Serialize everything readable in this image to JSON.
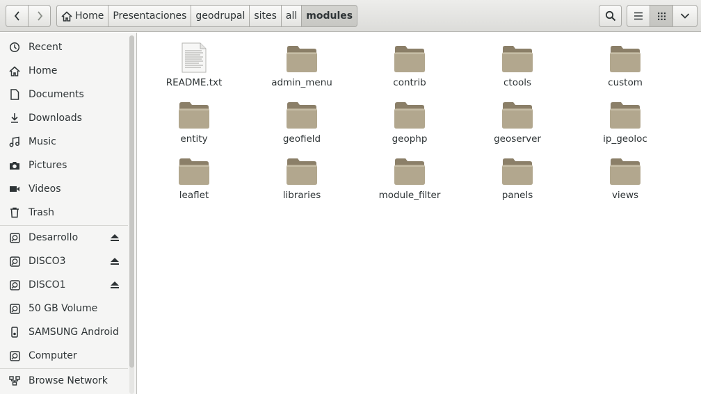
{
  "toolbar": {
    "back_icon": "chevron-left-icon",
    "forward_icon": "chevron-right-icon",
    "breadcrumbs": [
      "Home",
      "Presentaciones",
      "geodrupal",
      "sites",
      "all",
      "modules"
    ],
    "active_crumb": "modules",
    "search_icon": "search-icon",
    "list_view_icon": "list-view-icon",
    "grid_view_icon": "grid-view-icon",
    "menu_icon": "chevron-down-icon"
  },
  "sidebar": {
    "places": [
      {
        "label": "Recent",
        "icon": "clock-icon"
      },
      {
        "label": "Home",
        "icon": "home-icon"
      },
      {
        "label": "Documents",
        "icon": "document-icon"
      },
      {
        "label": "Downloads",
        "icon": "download-icon"
      },
      {
        "label": "Music",
        "icon": "music-icon"
      },
      {
        "label": "Pictures",
        "icon": "camera-icon"
      },
      {
        "label": "Videos",
        "icon": "video-icon"
      },
      {
        "label": "Trash",
        "icon": "trash-icon"
      }
    ],
    "devices": [
      {
        "label": "Desarrollo",
        "icon": "drive-icon",
        "eject": true
      },
      {
        "label": "DISCO3",
        "icon": "drive-icon",
        "eject": true
      },
      {
        "label": "DISCO1",
        "icon": "drive-icon",
        "eject": true
      },
      {
        "label": "50 GB Volume",
        "icon": "drive-icon",
        "eject": false
      },
      {
        "label": "SAMSUNG Android",
        "icon": "phone-icon",
        "eject": false
      },
      {
        "label": "Computer",
        "icon": "drive-icon",
        "eject": false
      }
    ],
    "network": [
      {
        "label": "Browse Network",
        "icon": "network-icon"
      }
    ]
  },
  "files": [
    {
      "name": "README.txt",
      "type": "text-file"
    },
    {
      "name": "admin_menu",
      "type": "folder"
    },
    {
      "name": "contrib",
      "type": "folder"
    },
    {
      "name": "ctools",
      "type": "folder"
    },
    {
      "name": "custom",
      "type": "folder"
    },
    {
      "name": "entity",
      "type": "folder"
    },
    {
      "name": "geofield",
      "type": "folder"
    },
    {
      "name": "geophp",
      "type": "folder"
    },
    {
      "name": "geoserver",
      "type": "folder"
    },
    {
      "name": "ip_geoloc",
      "type": "folder"
    },
    {
      "name": "leaflet",
      "type": "folder"
    },
    {
      "name": "libraries",
      "type": "folder"
    },
    {
      "name": "module_filter",
      "type": "folder"
    },
    {
      "name": "panels",
      "type": "folder"
    },
    {
      "name": "views",
      "type": "folder"
    }
  ],
  "colors": {
    "folder_body": "#b2a78e",
    "folder_dark": "#8b7f68",
    "sidebar_bg": "#f5f5f4",
    "header_bg": "#e4e4e1"
  }
}
